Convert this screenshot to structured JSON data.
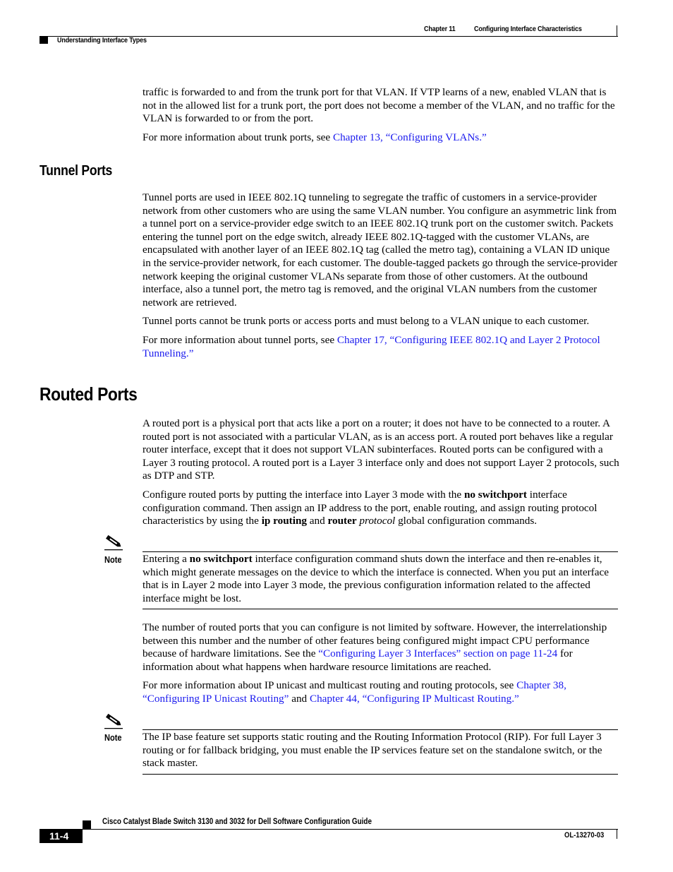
{
  "header": {
    "chapter": "Chapter 11",
    "chapter_title": "Configuring Interface Characteristics",
    "section": "Understanding Interface Types"
  },
  "intro": {
    "para1": "traffic is forwarded to and from the trunk port for that VLAN. If VTP learns of a new, enabled VLAN that is not in the allowed list for a trunk port, the port does not become a member of the VLAN, and no traffic for the VLAN is forwarded to or from the port.",
    "para2_prefix": "For more information about trunk ports, see ",
    "para2_link": "Chapter 13, “Configuring VLANs.”"
  },
  "tunnel_ports": {
    "heading": "Tunnel Ports",
    "para1": "Tunnel ports are used in IEEE 802.1Q tunneling to segregate the traffic of customers in a service-provider network from other customers who are using the same VLAN number. You configure an asymmetric link from a tunnel port on a service-provider edge switch to an IEEE 802.1Q trunk port on the customer switch. Packets entering the tunnel port on the edge switch, already IEEE 802.1Q-tagged with the customer VLANs, are encapsulated with another layer of an IEEE 802.1Q tag (called the metro tag), containing a VLAN ID unique in the service-provider network, for each customer. The double-tagged packets go through the service-provider network keeping the original customer VLANs separate from those of other customers. At the outbound interface, also a tunnel port, the metro tag is removed, and the original VLAN numbers from the customer network are retrieved.",
    "para2": "Tunnel ports cannot be trunk ports or access ports and must belong to a VLAN unique to each customer.",
    "para3_prefix": "For more information about tunnel ports, see ",
    "para3_link": "Chapter 17, “Configuring IEEE 802.1Q and Layer 2 Protocol Tunneling.”"
  },
  "routed_ports": {
    "heading": "Routed Ports",
    "para1": "A routed port is a physical port that acts like a port on a router; it does not have to be connected to a router. A routed port is not associated with a particular VLAN, as is an access port. A routed port behaves like a regular router interface, except that it does not support VLAN subinterfaces. Routed ports can be configured with a Layer 3 routing protocol. A routed port is a Layer 3 interface only and does not support Layer 2 protocols, such as DTP and STP.",
    "para2": {
      "t1": "Configure routed ports by putting the interface into Layer 3 mode with the ",
      "b1": "no switchport",
      "t2": " interface configuration command. Then assign an IP address to the port, enable routing, and assign routing protocol characteristics by using the ",
      "b2": "ip routing",
      "t3": " and ",
      "b3": "router",
      "t4": " ",
      "i1": "protocol",
      "t5": " global configuration commands."
    },
    "note1": {
      "label": "Note",
      "t1": "Entering a ",
      "b1": "no switchport",
      "t2": " interface configuration command shuts down the interface and then re-enables it, which might generate messages on the device to which the interface is connected. When you put an interface that is in Layer 2 mode into Layer 3 mode, the previous configuration information related to the affected interface might be lost."
    },
    "para3": {
      "t1": "The number of routed ports that you can configure is not limited by software. However, the interrelationship between this number and the number of other features being configured might impact CPU performance because of hardware limitations. See the ",
      "link": "“Configuring Layer 3 Interfaces” section on page 11-24",
      "t2": " for information about what happens when hardware resource limitations are reached."
    },
    "para4": {
      "t1": "For more information about IP unicast and multicast routing and routing protocols, see ",
      "link1": "Chapter 38, “Configuring IP Unicast Routing”",
      "t2": " and ",
      "link2": "Chapter 44, “Configuring IP Multicast Routing.”"
    },
    "note2": {
      "label": "Note",
      "text": "The IP base feature set supports static routing and the Routing Information Protocol (RIP). For full Layer 3 routing or for fallback bridging, you must enable the IP services feature set on the standalone switch, or the stack master."
    }
  },
  "footer": {
    "title": "Cisco Catalyst Blade Switch 3130 and 3032 for Dell Software Configuration Guide",
    "page": "11-4",
    "doc_number": "OL-13270-03"
  }
}
